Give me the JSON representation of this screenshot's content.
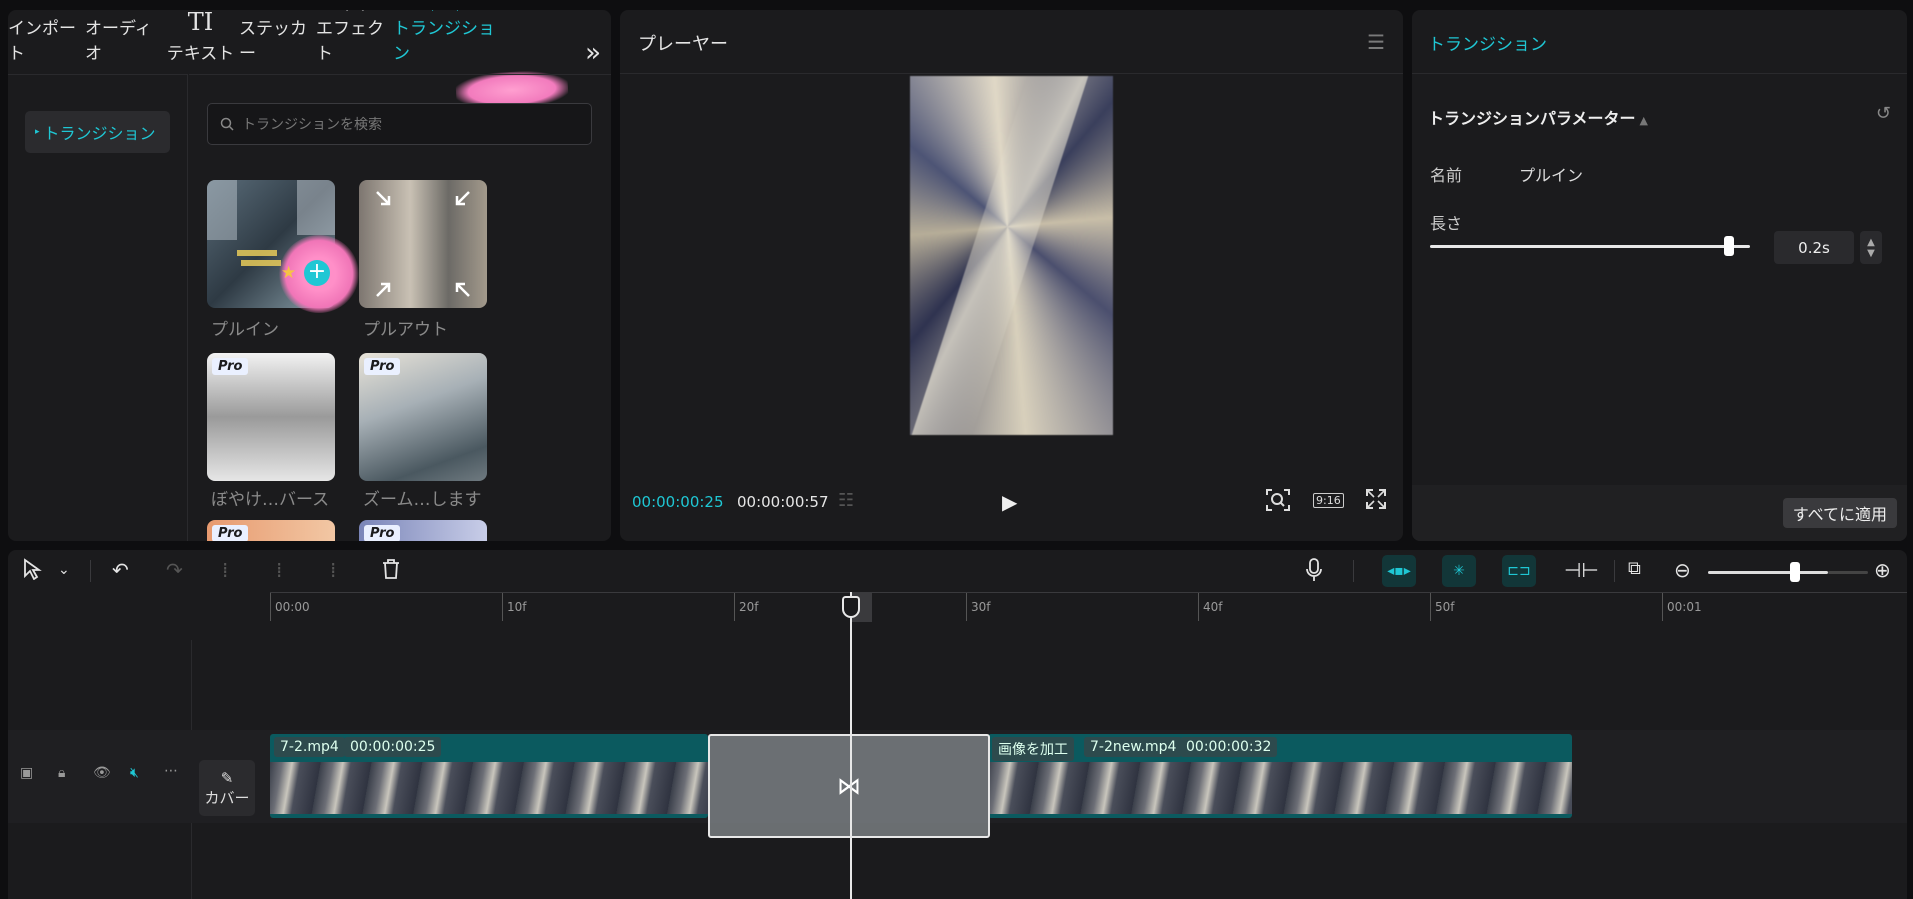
{
  "tabs": [
    {
      "label": "インポート",
      "icon": "import-icon"
    },
    {
      "label": "オーディオ",
      "icon": "audio-icon"
    },
    {
      "label": "テキスト",
      "icon": "text-icon"
    },
    {
      "label": "ステッカー",
      "icon": "sticker-icon"
    },
    {
      "label": "エフェクト",
      "icon": "effect-icon"
    },
    {
      "label": "トランジション",
      "icon": "transition-icon",
      "active": true
    }
  ],
  "sidebar": {
    "active_item": "トランジション"
  },
  "search": {
    "placeholder": "トランジションを検索"
  },
  "thumbnails": [
    {
      "label": "プルイン",
      "pro": false
    },
    {
      "label": "プルアウト",
      "pro": false
    },
    {
      "label": "ぼやけ…バース",
      "pro": true
    },
    {
      "label": "ズーム…します",
      "pro": true
    },
    {
      "label": "",
      "pro": true
    },
    {
      "label": "",
      "pro": true
    }
  ],
  "pro_badge": "Pro",
  "player": {
    "title": "プレーヤー",
    "current_time": "00:00:00:25",
    "total_time": "00:00:00:57",
    "ratio": "9:16"
  },
  "properties": {
    "title": "トランジション",
    "section_title": "トランジションパラメーター",
    "name_label": "名前",
    "name_value": "プルイン",
    "length_label": "長さ",
    "length_value": "0.2s",
    "length_fraction": 0.98,
    "apply_all": "すべてに適用"
  },
  "timeline": {
    "ruler_ticks": [
      "00:00",
      "10f",
      "20f",
      "30f",
      "40f",
      "50f",
      "00:01"
    ],
    "cover_label": "カバー",
    "clip_a": {
      "name": "7-2.mp4",
      "duration": "00:00:00:25"
    },
    "clip_b": {
      "tag": "画像を加工",
      "name": "7-2new.mp4",
      "duration": "00:00:00:32"
    },
    "zoom_fraction": 0.68
  },
  "colors": {
    "accent": "#1fc7d4",
    "clip": "#0b5a5f",
    "panel": "#1b1b1d"
  }
}
